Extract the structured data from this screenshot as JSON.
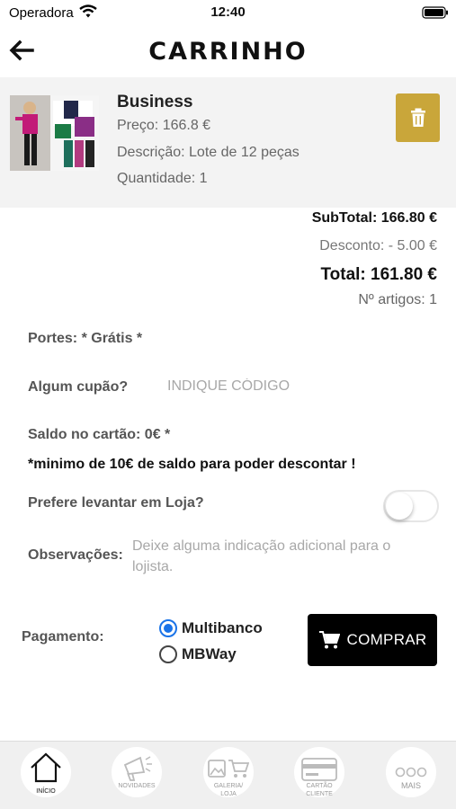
{
  "status_bar": {
    "carrier": "Operadora",
    "time": "12:40"
  },
  "header": {
    "title": "CARRINHO",
    "back_icon": "arrow-left-icon"
  },
  "cart_item": {
    "name": "Business",
    "price": "Preço: 166.8 €",
    "description": "Descrição: Lote de 12 peças",
    "quantity": "Quantidade: 1",
    "delete_icon": "trash-icon",
    "delete_color": "#c9a63a"
  },
  "totals": {
    "subtotal": "SubTotal: 166.80 €",
    "discount": "Desconto: - 5.00 €",
    "total": "Total: 161.80 €",
    "items_count": "Nº artigos: 1"
  },
  "form": {
    "shipping": "Portes: * Grátis *",
    "coupon_label": "Algum cupão?",
    "coupon_placeholder": "INDIQUE CÓDIGO",
    "balance": "Saldo no cartão: 0€ *",
    "balance_note": "*minimo de 10€ de saldo para poder descontar !",
    "pickup_label": "Prefere levantar em Loja?",
    "pickup_enabled": false,
    "notes_label": "Observações:",
    "notes_placeholder": "Deixe alguma indicação adicional para o lojista."
  },
  "payment": {
    "label": "Pagamento:",
    "options": [
      {
        "label": "Multibanco",
        "selected": true
      },
      {
        "label": "MBWay",
        "selected": false
      }
    ],
    "selected_color": "#1a73e8",
    "buy_label": "COMPRAR",
    "buy_icon": "shopping-cart-icon"
  },
  "tabbar": {
    "tabs": [
      {
        "label": "INÍCIO",
        "icon": "home-icon",
        "active": true
      },
      {
        "label": "NOVIDADES",
        "icon": "megaphone-icon",
        "active": false
      },
      {
        "label": "GALERIA/",
        "label2": "LOJA",
        "icon": "gallery-cart-icon",
        "active": false
      },
      {
        "label": "CARTÃO",
        "label2": "CLIENTE",
        "icon": "card-icon",
        "active": false
      },
      {
        "label": "MAIS",
        "icon": "more-dots-icon",
        "active": false
      }
    ]
  }
}
